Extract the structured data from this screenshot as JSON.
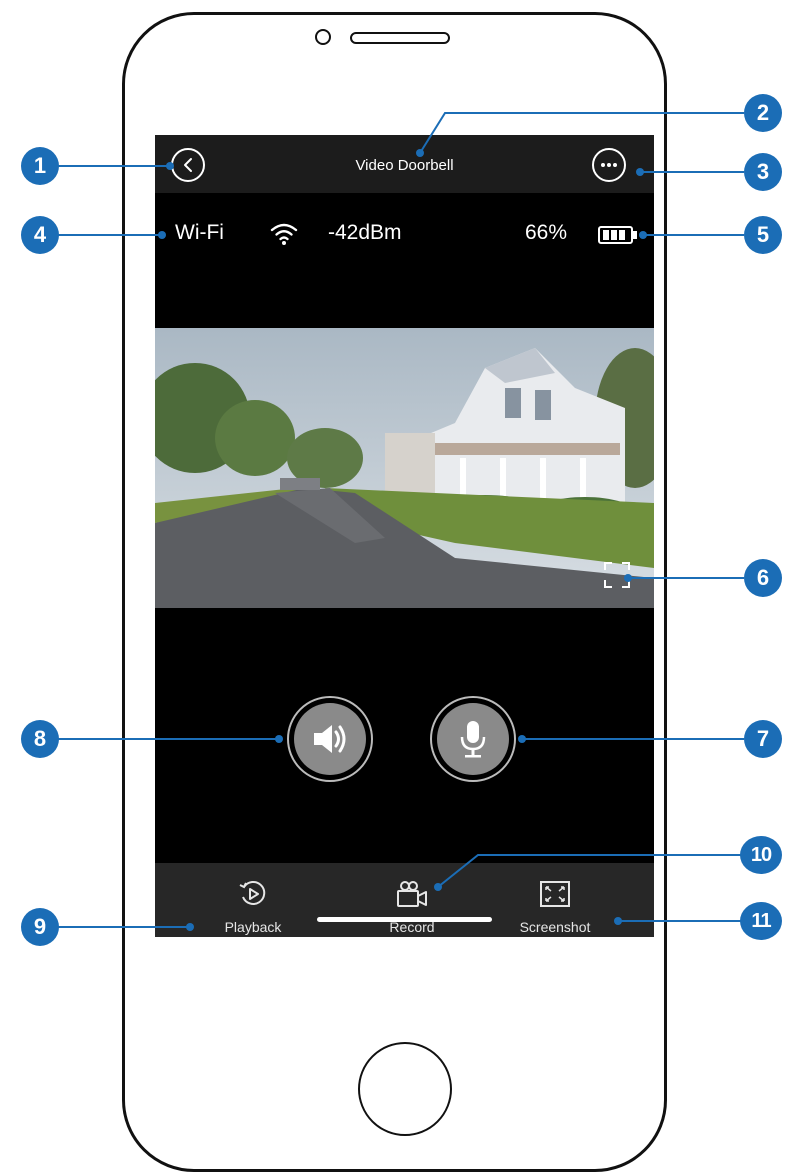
{
  "screen": {
    "title": "Video Doorbell",
    "wifi_label": "Wi-Fi",
    "wifi_signal": "-42dBm",
    "battery_percent": "66%"
  },
  "toolbar": {
    "items": [
      {
        "label": "Playback",
        "icon": "playback-icon"
      },
      {
        "label": "Record",
        "icon": "video-camera-icon"
      },
      {
        "label": "Screenshot",
        "icon": "screenshot-icon"
      }
    ]
  },
  "callouts": [
    "1",
    "2",
    "3",
    "4",
    "5",
    "6",
    "7",
    "8",
    "9",
    "10",
    "11"
  ],
  "colors": {
    "callout": "#1b6db6",
    "screen_bg": "#000000",
    "topbar_bg": "#1c1c1c",
    "bottombar_bg": "#272727",
    "talk_button": "#8a8a8a"
  }
}
